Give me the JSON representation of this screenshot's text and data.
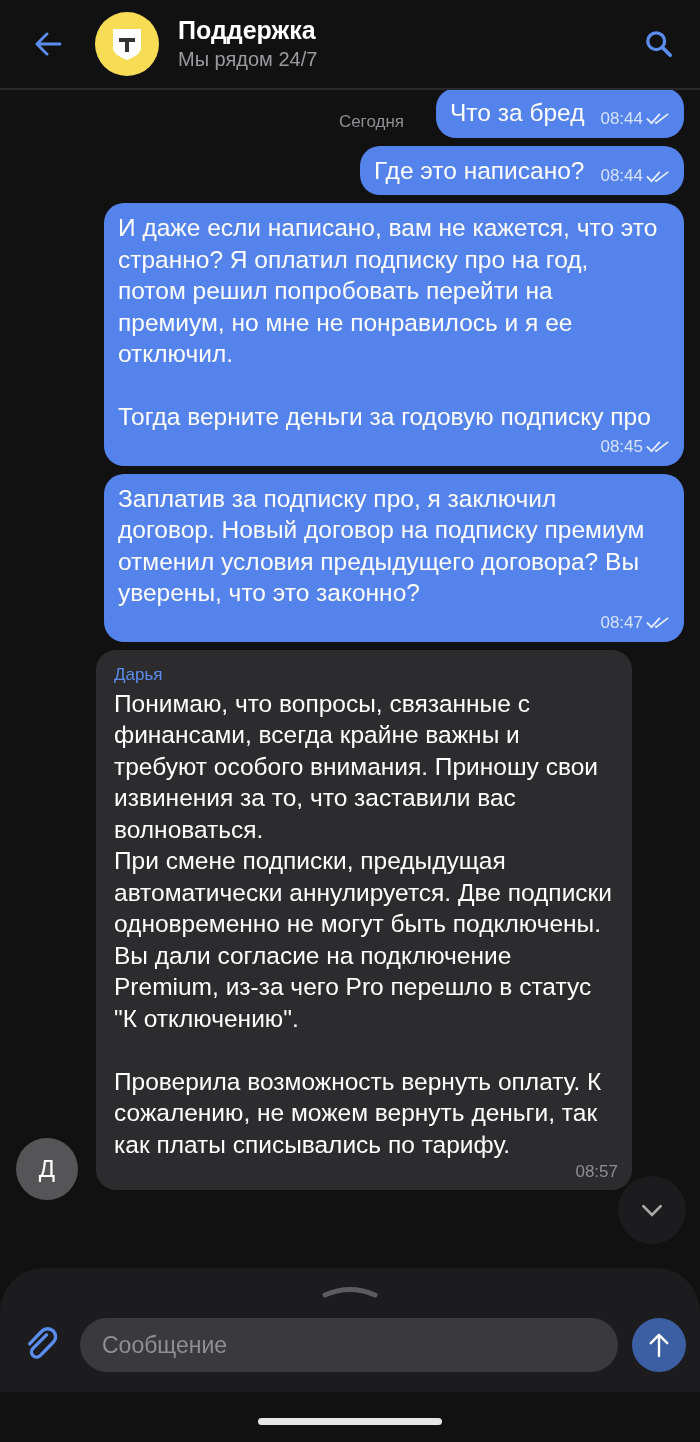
{
  "header": {
    "title": "Поддержка",
    "subtitle": "Мы рядом 24/7"
  },
  "date_label": "Сегодня",
  "messages": [
    {
      "kind": "outgoing",
      "text": "Что за бред",
      "time": "08:44",
      "read": true
    },
    {
      "kind": "outgoing",
      "text": "Где это написано?",
      "time": "08:44",
      "read": true
    },
    {
      "kind": "outgoing",
      "text": "И даже если написано, вам не кажется, что это странно? Я оплатил подписку про на год, потом решил попробовать перейти на премиум, но мне не понравилось и я ее отключил.\n\nТогда верните деньги за годовую подписку про",
      "time": "08:45",
      "read": true
    },
    {
      "kind": "outgoing",
      "text": "Заплатив за подписку про, я заключил договор. Новый договор на подписку премиум отменил условия предыдущего договора? Вы уверены, что это законно?",
      "time": "08:47",
      "read": true
    },
    {
      "kind": "incoming",
      "sender": "Дарья",
      "avatar": "Д",
      "text": "Понимаю, что вопросы, связанные с финансами, всегда крайне важны и требуют особого внимания. Приношу свои извинения за то, что заставили вас волноваться.\nПри смене подписки, предыдущая автоматически аннулируется. Две подписки одновременно не могут быть подключены. Вы дали согласие на подключение Premium, из-за чего Pro перешло в статус \"К отключению\".\n\nПроверила возможность вернуть оплату. К сожалению, не можем вернуть деньги, так как платы списывались по тарифу.",
      "time": "08:57"
    }
  ],
  "composer": {
    "placeholder": "Сообщение"
  }
}
